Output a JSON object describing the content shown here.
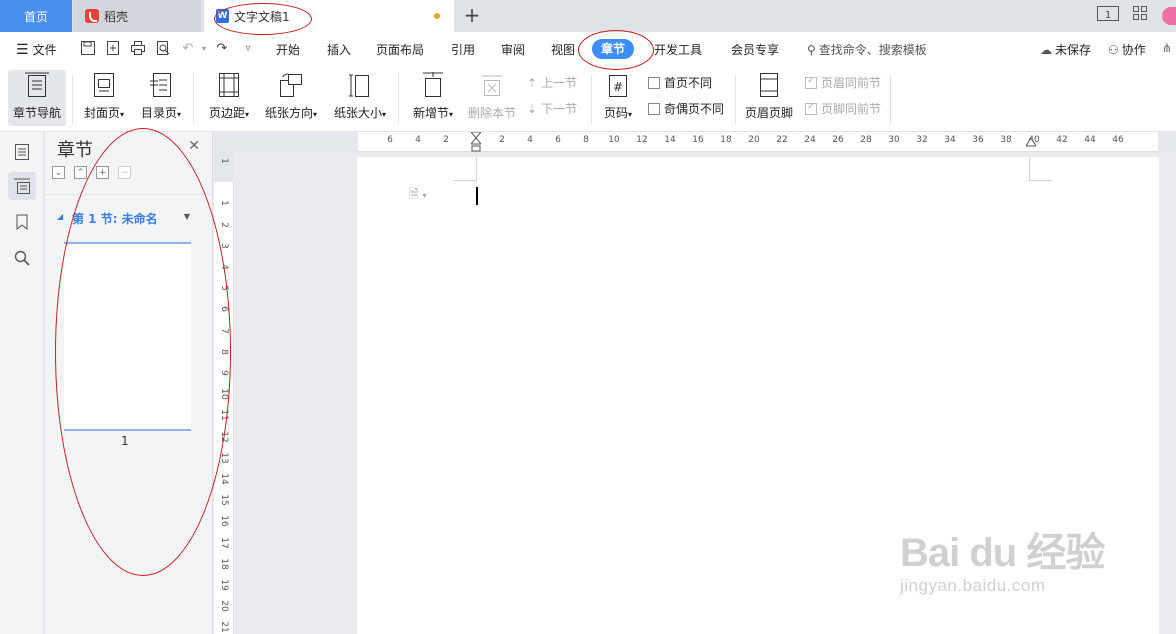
{
  "titlebar": {
    "tabs": [
      {
        "label": "首页"
      },
      {
        "label": "稻壳"
      },
      {
        "label": "文字文稿1"
      }
    ],
    "page_indicator": "1"
  },
  "menubar": {
    "file_label": "文件",
    "items": [
      "开始",
      "插入",
      "页面布局",
      "引用",
      "审阅",
      "视图",
      "章节",
      "开发工具",
      "会员专享"
    ],
    "active": "章节",
    "search_placeholder": "查找命令、搜索模板",
    "unsaved_label": "未保存",
    "collab_label": "协作"
  },
  "ribbon": {
    "section_nav": "章节导航",
    "cover_page": "封面页",
    "toc_page": "目录页",
    "margins": "页边距",
    "orientation": "纸张方向",
    "paper_size": "纸张大小",
    "new_section": "新增节",
    "delete_section": "删除本节",
    "prev_section": "上一节",
    "next_section": "下一节",
    "page_number": "页码",
    "first_page_diff": "首页不同",
    "odd_even_diff": "奇偶页不同",
    "header_footer": "页眉页脚",
    "header_same_prev": "页眉同前节",
    "footer_same_prev": "页脚同前节"
  },
  "pane": {
    "title": "章节",
    "section_label": "第 1 节: 未命名",
    "page_number": "1"
  },
  "ruler": {
    "h_ticks": [
      "6",
      "4",
      "2",
      "",
      "2",
      "4",
      "6",
      "8",
      "10",
      "12",
      "14",
      "16",
      "18",
      "20",
      "22",
      "24",
      "26",
      "28",
      "30",
      "32",
      "34",
      "36",
      "38",
      "40",
      "42",
      "44",
      "46"
    ],
    "v_ticks": [
      "1",
      "",
      "1",
      "2",
      "3",
      "4",
      "5",
      "6",
      "7",
      "8",
      "9",
      "10",
      "11",
      "12",
      "13",
      "14",
      "15",
      "16",
      "17",
      "18",
      "19",
      "20",
      "21"
    ]
  },
  "watermark": {
    "logo": "Bai du 经验",
    "url": "jingyan.baidu.com"
  }
}
